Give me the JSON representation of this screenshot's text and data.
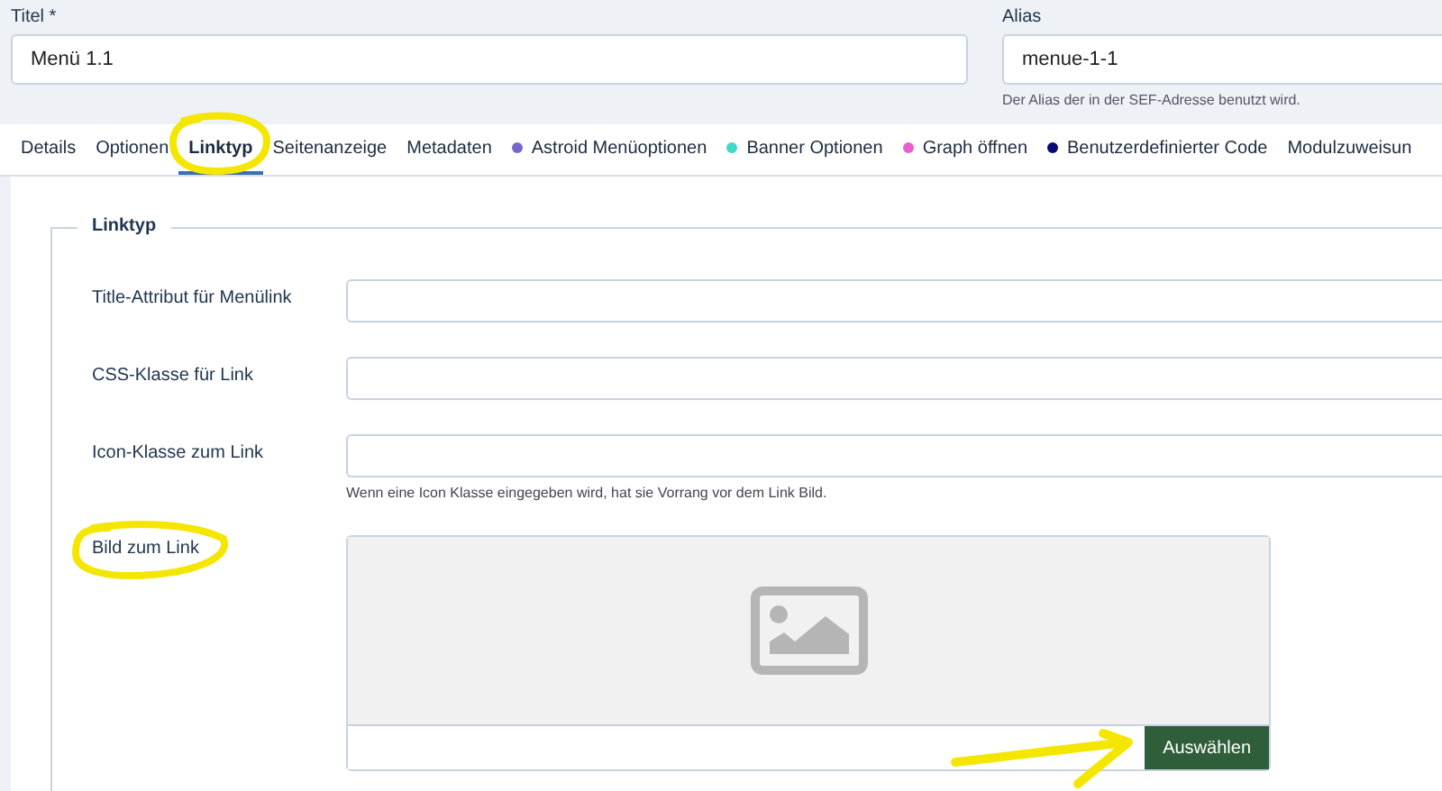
{
  "title_field": {
    "label": "Titel *",
    "value": "Menü 1.1"
  },
  "alias_field": {
    "label": "Alias",
    "value": "menue-1-1",
    "hint": "Der Alias der in der SEF-Adresse benutzt wird."
  },
  "tabs": [
    {
      "label": "Details",
      "selected": false
    },
    {
      "label": "Optionen",
      "selected": false
    },
    {
      "label": "Linktyp",
      "selected": true
    },
    {
      "label": "Seitenanzeige",
      "selected": false
    },
    {
      "label": "Metadaten",
      "selected": false
    },
    {
      "label": "Astroid Menüoptionen",
      "selected": false,
      "color": "#7468d0"
    },
    {
      "label": "Banner Optionen",
      "selected": false,
      "color": "#3fd8c6"
    },
    {
      "label": "Graph öffnen",
      "selected": false,
      "color": "#e85fcb"
    },
    {
      "label": "Benutzerdefinierter Code",
      "selected": false,
      "color": "#0b0b78"
    },
    {
      "label": "Modulzuweisun",
      "selected": false
    }
  ],
  "fieldset": {
    "legend": "Linktyp",
    "fields": [
      {
        "kind": "text",
        "label": "Title-Attribut für Menülink"
      },
      {
        "kind": "text",
        "label": "CSS-Klasse für Link"
      },
      {
        "kind": "text",
        "label": "Icon-Klasse zum Link",
        "hint": "Wenn eine Icon Klasse eingegeben wird, hat sie Vorrang vor dem Link Bild."
      },
      {
        "kind": "image",
        "label": "Bild zum Link",
        "button": "Auswählen"
      }
    ]
  }
}
